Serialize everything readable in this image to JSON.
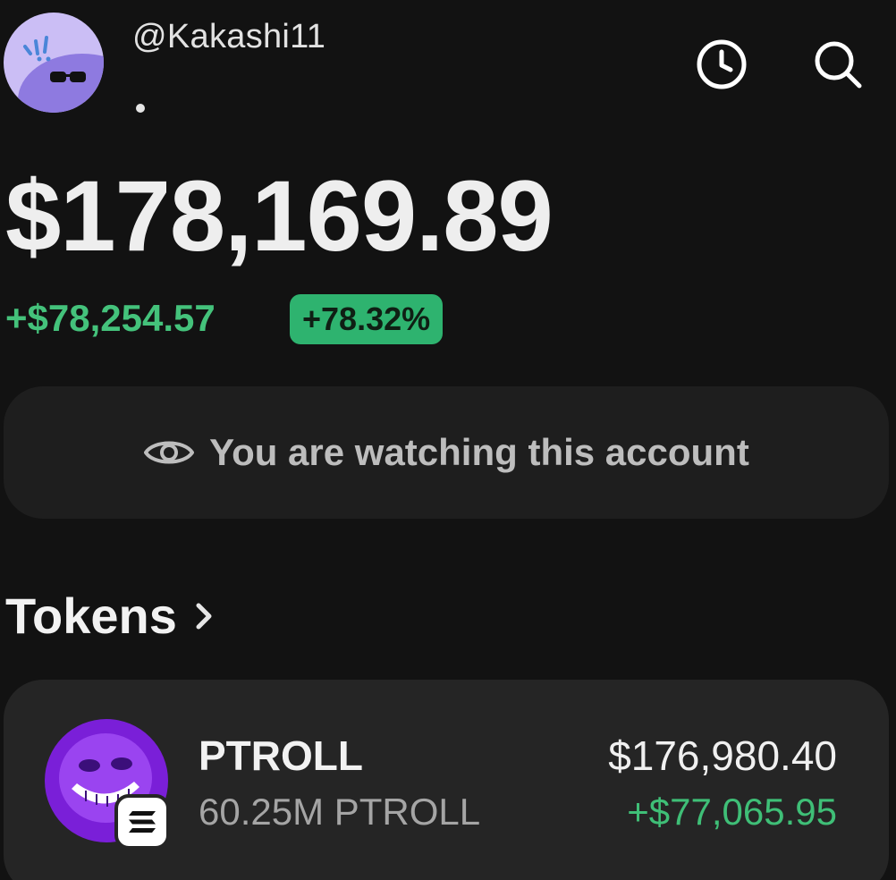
{
  "header": {
    "handle": "@Kakashi11",
    "subtitle_dot": ".",
    "history_icon": "history-clock-icon",
    "search_icon": "search-icon"
  },
  "portfolio": {
    "balance": "$178,169.89",
    "change_value": "+$78,254.57",
    "change_percent": "+78.32%"
  },
  "watch_banner": {
    "icon": "eye-icon",
    "text": "You are watching this account"
  },
  "tokens": {
    "title": "Tokens",
    "items": [
      {
        "symbol": "PTROLL",
        "amount": "60.25M PTROLL",
        "value": "$176,980.40",
        "change": "+$77,065.95",
        "chain_icon": "solana-icon"
      }
    ]
  },
  "colors": {
    "background": "#121212",
    "positive": "#44c27b",
    "badge": "#2eb36f",
    "card": "#252525",
    "banner": "#1e1e1e",
    "avatar": "#cbbef5",
    "token_logo": "#7a1fd8"
  }
}
